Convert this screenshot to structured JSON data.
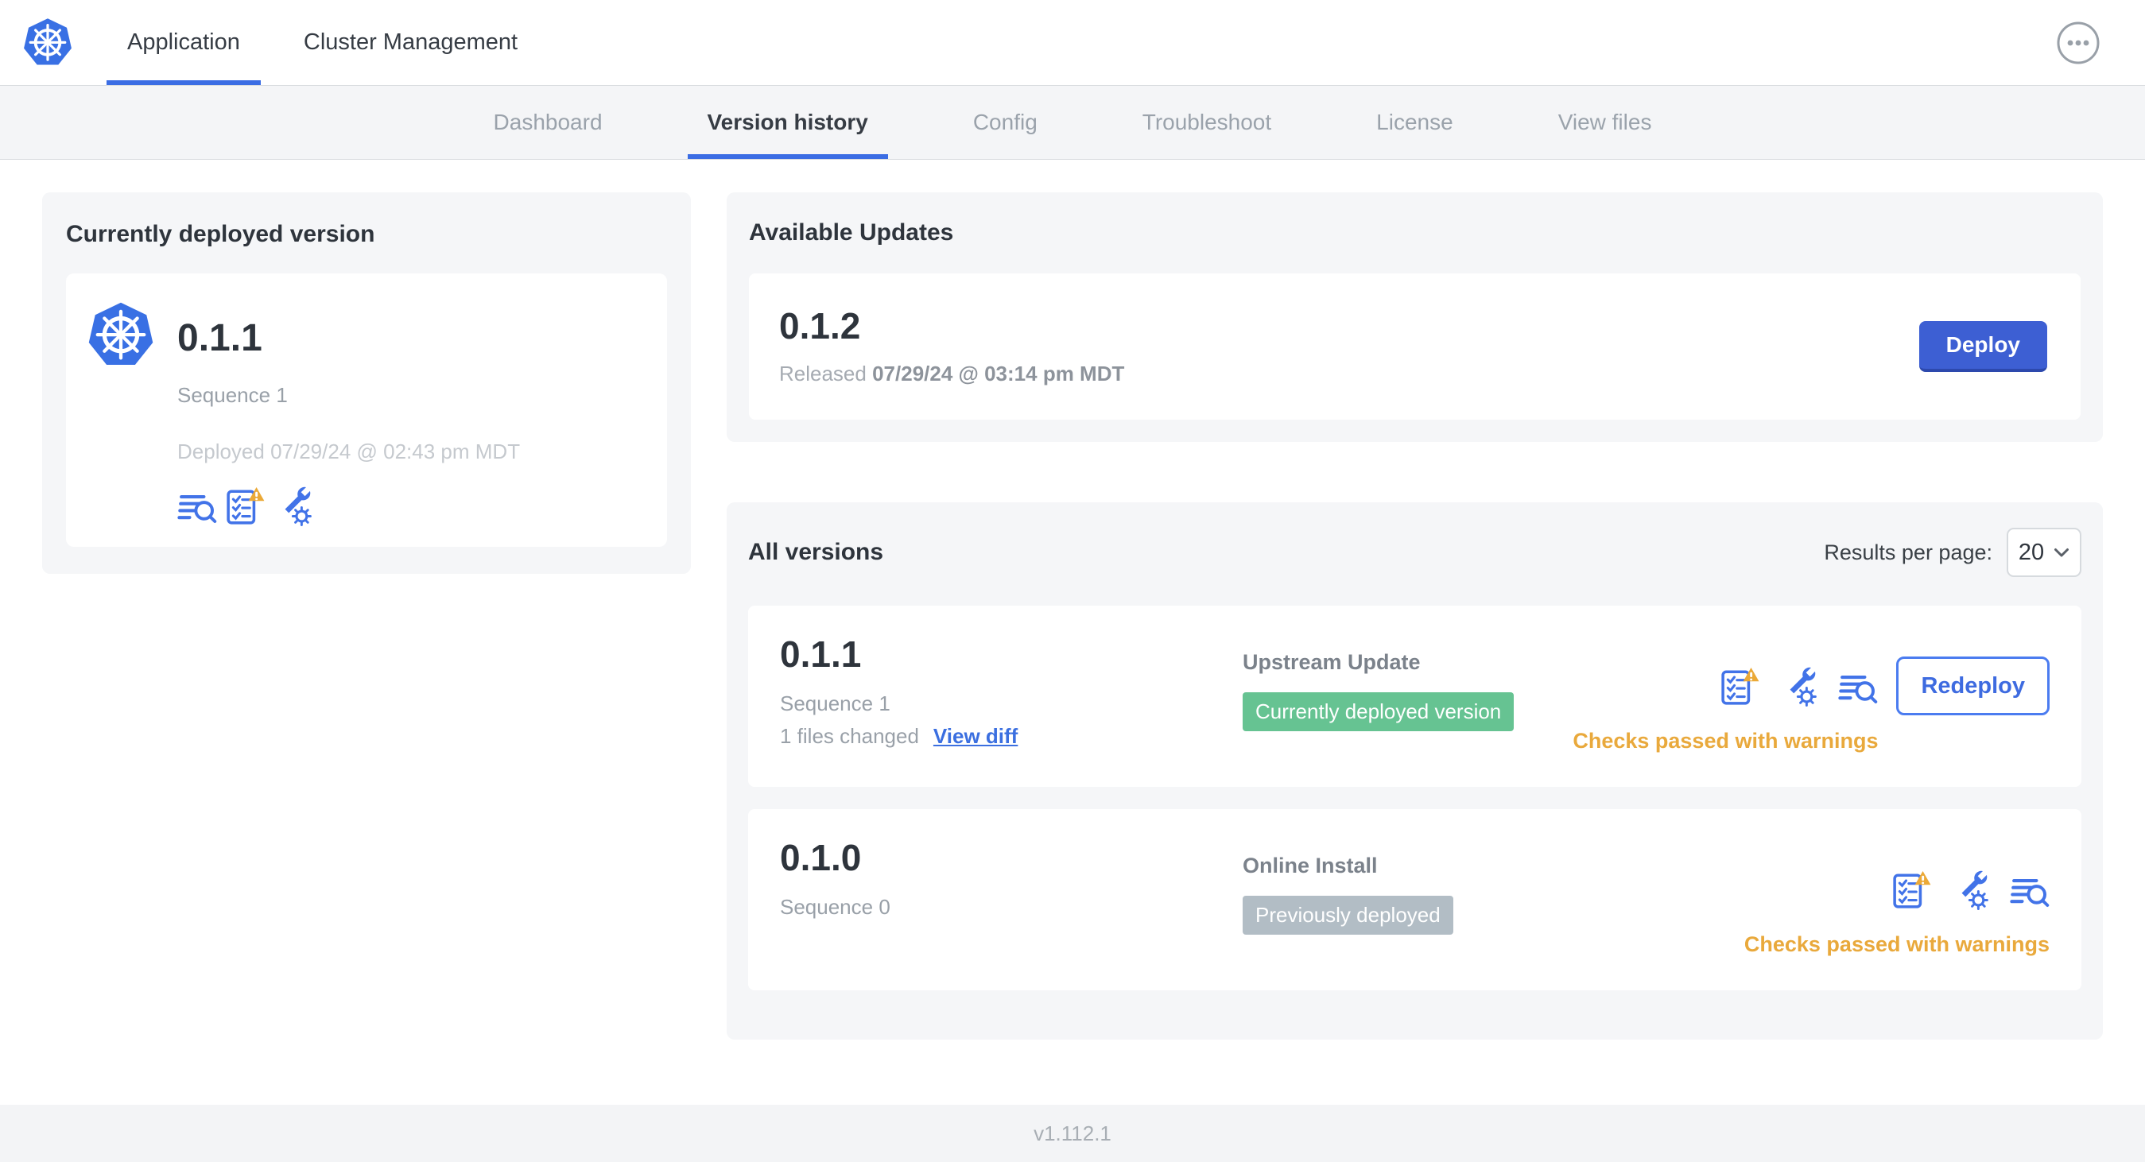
{
  "header": {
    "logo_icon": "kubernetes-logo",
    "tabs": [
      {
        "label": "Application",
        "active": true
      },
      {
        "label": "Cluster Management",
        "active": false
      }
    ],
    "menu_icon": "ellipsis-icon"
  },
  "subnav": {
    "tabs": [
      {
        "label": "Dashboard",
        "active": false
      },
      {
        "label": "Version history",
        "active": true
      },
      {
        "label": "Config",
        "active": false
      },
      {
        "label": "Troubleshoot",
        "active": false
      },
      {
        "label": "License",
        "active": false
      },
      {
        "label": "View files",
        "active": false
      }
    ]
  },
  "current_version_card": {
    "title": "Currently deployed version",
    "version": "0.1.1",
    "sequence": "Sequence 1",
    "deployed": "Deployed 07/29/24 @ 02:43 pm MDT",
    "icons": [
      "deploy-logs-icon",
      "preflight-checks-warning-icon",
      "config-values-icon"
    ]
  },
  "available_updates": {
    "title": "Available Updates",
    "version": "0.1.2",
    "released_prefix": "Released",
    "released_date": "07/29/24 @ 03:14 pm MDT",
    "deploy_label": "Deploy"
  },
  "all_versions": {
    "title": "All versions",
    "results_per_page_label": "Results per page:",
    "results_per_page_value": "20",
    "rows": [
      {
        "version": "0.1.1",
        "sequence": "Sequence 1",
        "files_changed": "1 files changed",
        "view_diff_label": "View diff",
        "source": "Upstream Update",
        "badge": "Currently deployed version",
        "badge_type": "green",
        "icons": [
          "preflight-checks-warning-icon",
          "config-values-icon",
          "deploy-logs-icon"
        ],
        "checks_status": "Checks passed with warnings",
        "action_label": "Redeploy"
      },
      {
        "version": "0.1.0",
        "sequence": "Sequence 0",
        "source": "Online Install",
        "badge": "Previously deployed",
        "badge_type": "gray",
        "icons": [
          "preflight-checks-warning-icon",
          "config-values-icon",
          "deploy-logs-icon"
        ],
        "checks_status": "Checks passed with warnings"
      }
    ]
  },
  "footer": {
    "version": "v1.112.1"
  },
  "colors": {
    "accent_blue": "#3b6de4",
    "button_blue": "#3d5fd3",
    "icon_blue": "#4273e8",
    "badge_green": "#66c392",
    "badge_gray": "#b2bdc5",
    "warning_amber": "#e9a93c",
    "card_bg": "#f5f6f8",
    "text_dark": "#2e343c",
    "text_gray": "#99a0a8"
  }
}
